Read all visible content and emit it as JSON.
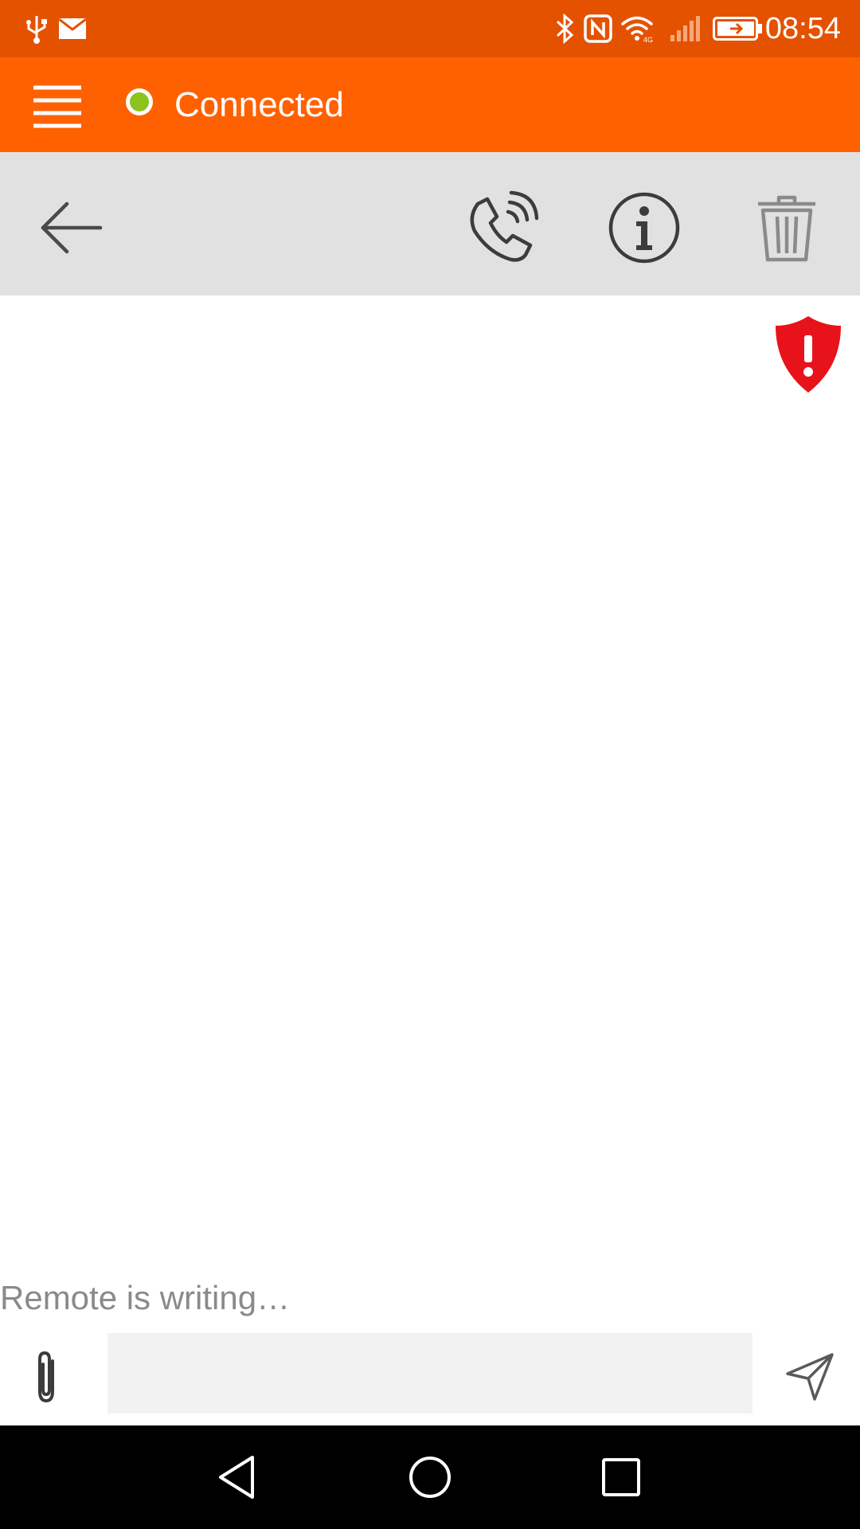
{
  "status_bar": {
    "time": "08:54",
    "icons": [
      "usb-icon",
      "mail-icon",
      "bluetooth-icon",
      "nfc-icon",
      "wifi-icon",
      "signal-icon",
      "battery-charging-icon"
    ]
  },
  "app_bar": {
    "connection_label": "Connected",
    "connection_color": "#8ec21e",
    "accent_color": "#ff6100"
  },
  "toolbar": {
    "icons": [
      "back-arrow-icon",
      "call-icon",
      "info-icon",
      "trash-icon"
    ]
  },
  "content": {
    "security_icon": "shield-alert-icon",
    "security_color": "#e8121b"
  },
  "chat": {
    "typing_status": "Remote is writing…",
    "message_input_value": "",
    "message_input_placeholder": ""
  },
  "nav_bar": {
    "icons": [
      "nav-back-icon",
      "nav-home-icon",
      "nav-recents-icon"
    ]
  }
}
